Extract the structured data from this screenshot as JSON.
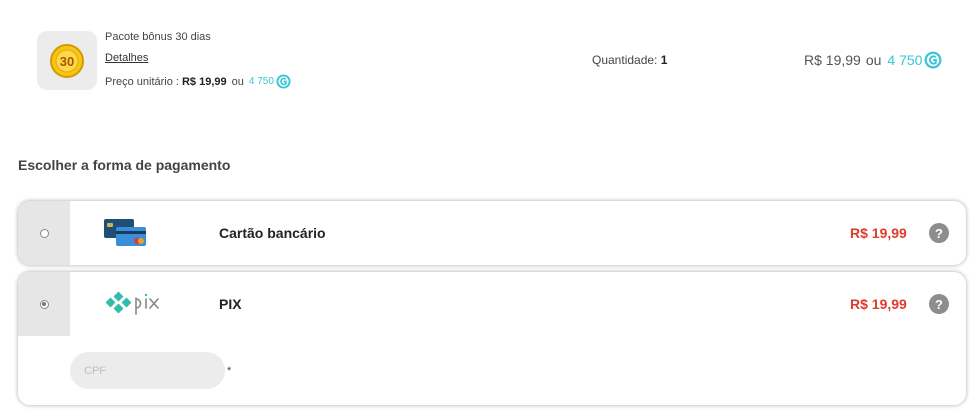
{
  "product": {
    "badge_text": "30",
    "title": "Pacote bônus 30 dias",
    "details_link": "Detalhes",
    "unit_price_label": "Preço unitário :",
    "unit_price": "R$ 19,99",
    "or": "ou",
    "unit_coins": "4 750",
    "quantity_label": "Quantidade:",
    "quantity": "1",
    "total_price": "R$ 19,99",
    "total_coins": "4 750"
  },
  "payment": {
    "section_title": "Escolher a forma de pagamento",
    "methods": [
      {
        "name": "Cartão bancário",
        "price": "R$ 19,99",
        "selected": false,
        "icon": "credit-card-icon"
      },
      {
        "name": "PIX",
        "price": "R$ 19,99",
        "selected": true,
        "icon": "pix-logo-icon"
      }
    ],
    "help_glyph": "?",
    "cpf_placeholder": "CPF",
    "required_mark": "*"
  },
  "colors": {
    "price_red": "#e03a2b",
    "coin_cyan": "#39c6d8",
    "pix_teal": "#32bcad",
    "radio_bg": "#e6e6e6"
  }
}
